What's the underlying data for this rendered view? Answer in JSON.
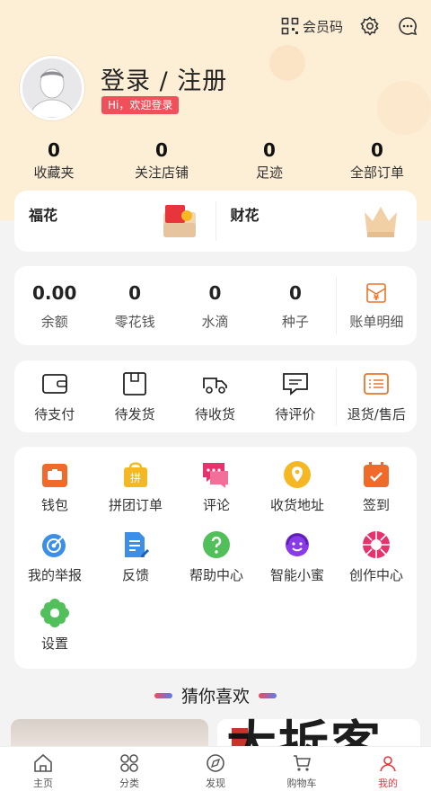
{
  "header": {
    "member_code": "会员码"
  },
  "profile": {
    "title": "登录 / 注册",
    "welcome": "Hi，欢迎登录"
  },
  "stats": [
    {
      "value": "0",
      "label": "收藏夹"
    },
    {
      "value": "0",
      "label": "关注店铺"
    },
    {
      "value": "0",
      "label": "足迹"
    },
    {
      "value": "0",
      "label": "全部订单"
    }
  ],
  "flower": {
    "fuhua": "福花",
    "caihua": "财花"
  },
  "wallet": {
    "items": [
      {
        "value": "0.00",
        "label": "余额"
      },
      {
        "value": "0",
        "label": "零花钱"
      },
      {
        "value": "0",
        "label": "水滴"
      },
      {
        "value": "0",
        "label": "种子"
      }
    ],
    "bill": "账单明细",
    "bill_icon_text": "¥"
  },
  "orders": {
    "items": [
      {
        "label": "待支付"
      },
      {
        "label": "待发货"
      },
      {
        "label": "待收货"
      },
      {
        "label": "待评价"
      }
    ],
    "refund": "退货/售后"
  },
  "services": [
    {
      "label": "钱包",
      "icon": "wallet-icon",
      "color": "#f06a2a"
    },
    {
      "label": "拼团订单",
      "icon": "group-order-icon",
      "color": "#f5b822"
    },
    {
      "label": "评论",
      "icon": "comment-icon",
      "color": "#e8326e"
    },
    {
      "label": "收货地址",
      "icon": "location-icon",
      "color": "#f5b822"
    },
    {
      "label": "签到",
      "icon": "checkin-icon",
      "color": "#f06a2a"
    },
    {
      "label": "我的举报",
      "icon": "report-icon",
      "color": "#3b8fe8"
    },
    {
      "label": "反馈",
      "icon": "feedback-icon",
      "color": "#3b8fe8"
    },
    {
      "label": "帮助中心",
      "icon": "help-icon",
      "color": "#52c05a"
    },
    {
      "label": "智能小蜜",
      "icon": "assistant-icon",
      "color": "#8a3be8"
    },
    {
      "label": "创作中心",
      "icon": "create-icon",
      "color": "#e8326e"
    },
    {
      "label": "设置",
      "icon": "settings-icon",
      "color": "#52c05a"
    }
  ],
  "group_icon_text": "拼",
  "guess": {
    "title": "猜你喜欢"
  },
  "watermark": "大拆客",
  "tabs": [
    {
      "label": "主页",
      "icon": "home-icon"
    },
    {
      "label": "分类",
      "icon": "category-icon"
    },
    {
      "label": "发现",
      "icon": "discover-icon"
    },
    {
      "label": "购物车",
      "icon": "cart-icon"
    },
    {
      "label": "我的",
      "icon": "profile-icon"
    }
  ]
}
